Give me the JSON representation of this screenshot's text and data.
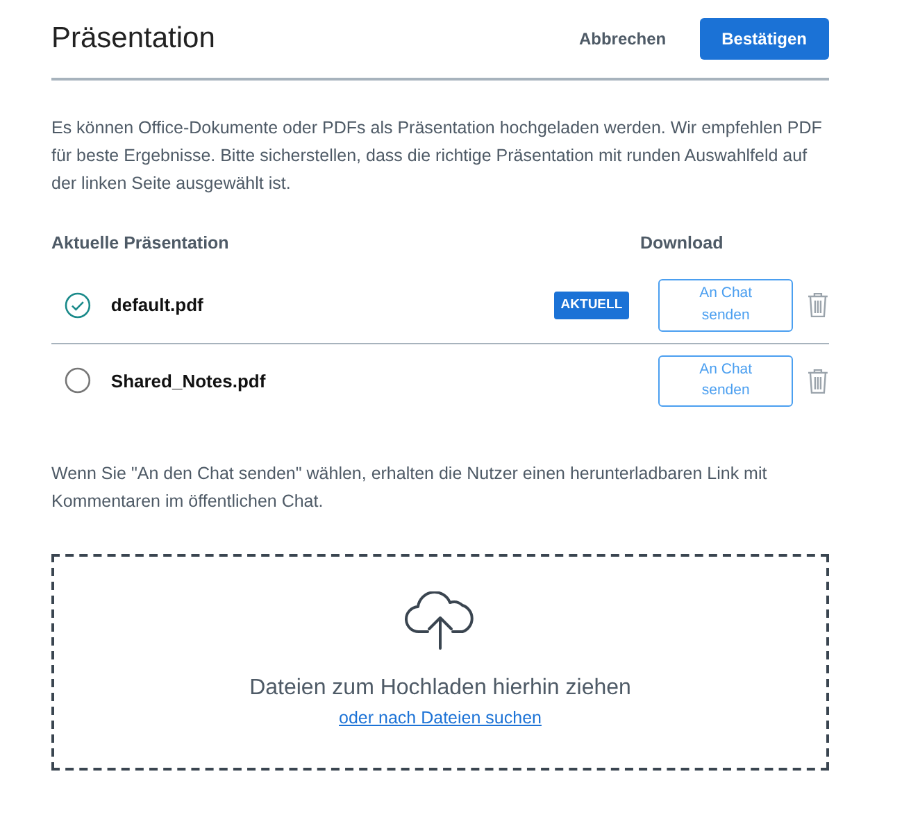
{
  "header": {
    "title": "Präsentation",
    "cancel": "Abbrechen",
    "confirm": "Bestätigen"
  },
  "intro": "Es können Office-Dokumente oder PDFs als Präsentation hochgeladen werden. Wir empfehlen PDF für beste Ergebnisse. Bitte sicherstellen, dass die richtige Präsentation mit runden Auswahlfeld auf der linken Seite ausgewählt ist.",
  "columns": [
    "Aktuelle Präsentation",
    "Download"
  ],
  "files": [
    {
      "name": "default.pdf",
      "selected": true,
      "badge": "AKTUELL",
      "send": "An Chat senden"
    },
    {
      "name": "Shared_Notes.pdf",
      "selected": false,
      "send": "An Chat senden"
    }
  ],
  "note": "Wenn Sie \"An den Chat senden\" wählen, erhalten die Nutzer einen herunterladbaren Link mit Kommentaren im öffentlichen Chat.",
  "dropzone": {
    "title": "Dateien zum Hochladen hierhin ziehen",
    "link": "oder nach Dateien suchen"
  }
}
